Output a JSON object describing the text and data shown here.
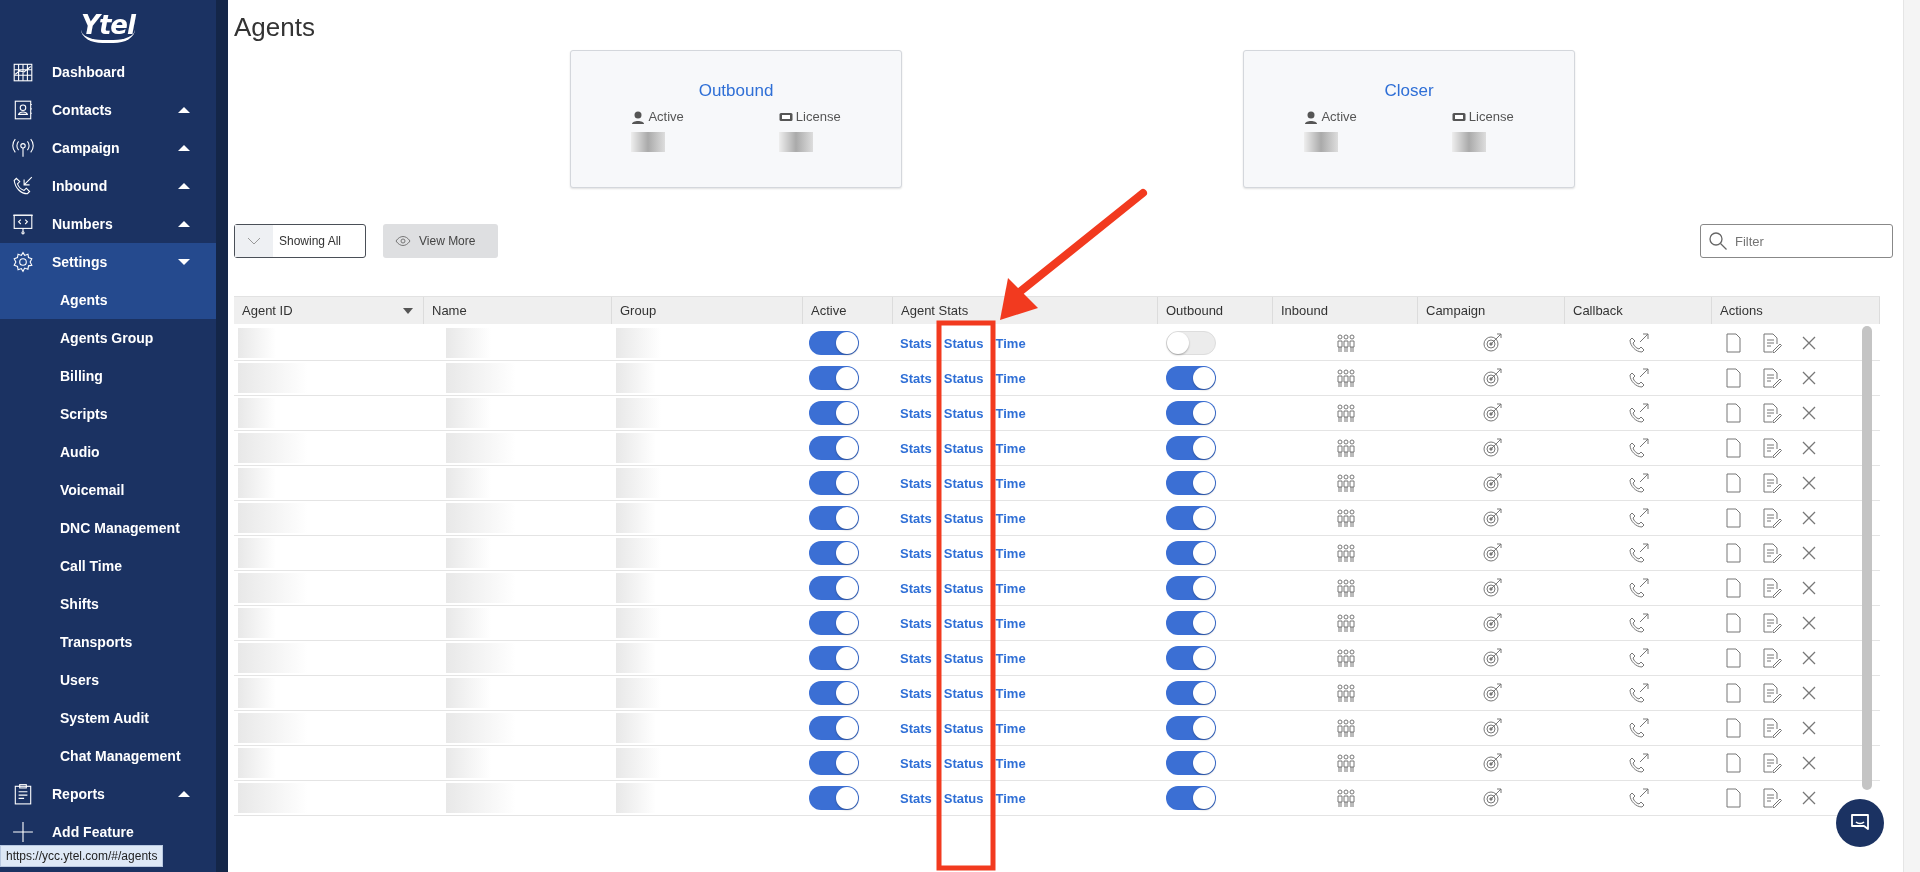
{
  "sidebar": {
    "logo": "Ytel",
    "items": [
      {
        "kind": "link",
        "label": "Dashboard"
      },
      {
        "kind": "group",
        "label": "Contacts",
        "expanded": false
      },
      {
        "kind": "group",
        "label": "Campaign",
        "expanded": false
      },
      {
        "kind": "group",
        "label": "Inbound",
        "expanded": false
      },
      {
        "kind": "group",
        "label": "Numbers",
        "expanded": false
      },
      {
        "kind": "group",
        "label": "Settings",
        "expanded": true,
        "children": [
          {
            "label": "Agents",
            "selected": true
          },
          {
            "label": "Agents Group",
            "selected": false
          },
          {
            "label": "Billing",
            "selected": false
          },
          {
            "label": "Scripts",
            "selected": false
          },
          {
            "label": "Audio",
            "selected": false
          },
          {
            "label": "Voicemail",
            "selected": false
          },
          {
            "label": "DNC Management",
            "selected": false
          },
          {
            "label": "Call Time",
            "selected": false
          },
          {
            "label": "Shifts",
            "selected": false
          },
          {
            "label": "Transports",
            "selected": false
          },
          {
            "label": "Users",
            "selected": false
          },
          {
            "label": "System Audit",
            "selected": false
          },
          {
            "label": "Chat Management",
            "selected": false
          }
        ]
      },
      {
        "kind": "group",
        "label": "Reports",
        "expanded": false
      },
      {
        "kind": "link",
        "label": "Add Feature"
      }
    ]
  },
  "link_preview": "https://ycc.ytel.com/#/agents",
  "page_title": "Agents",
  "cards": [
    {
      "title": "Outbound",
      "active_label": "Active",
      "license_label": "License"
    },
    {
      "title": "Closer",
      "active_label": "Active",
      "license_label": "License"
    }
  ],
  "toolbar": {
    "filter_button": "Showing All",
    "view_more_button": "View More",
    "search": {
      "placeholder": "Filter"
    }
  },
  "table": {
    "columns": [
      "Agent ID",
      "Name",
      "Group",
      "Active",
      "Agent Stats",
      "Outbound",
      "Inbound",
      "Campaign",
      "Callback",
      "Actions"
    ],
    "rows": [
      {
        "active": true,
        "outbound": false,
        "links": [
          "Stats",
          "Status",
          "Time"
        ]
      },
      {
        "active": true,
        "outbound": true,
        "links": [
          "Stats",
          "Status",
          "Time"
        ]
      },
      {
        "active": true,
        "outbound": true,
        "links": [
          "Stats",
          "Status",
          "Time"
        ]
      },
      {
        "active": true,
        "outbound": true,
        "links": [
          "Stats",
          "Status",
          "Time"
        ]
      },
      {
        "active": true,
        "outbound": true,
        "links": [
          "Stats",
          "Status",
          "Time"
        ]
      },
      {
        "active": true,
        "outbound": true,
        "links": [
          "Stats",
          "Status",
          "Time"
        ]
      },
      {
        "active": true,
        "outbound": true,
        "links": [
          "Stats",
          "Status",
          "Time"
        ]
      },
      {
        "active": true,
        "outbound": true,
        "links": [
          "Stats",
          "Status",
          "Time"
        ]
      },
      {
        "active": true,
        "outbound": true,
        "links": [
          "Stats",
          "Status",
          "Time"
        ]
      },
      {
        "active": true,
        "outbound": true,
        "links": [
          "Stats",
          "Status",
          "Time"
        ]
      },
      {
        "active": true,
        "outbound": true,
        "links": [
          "Stats",
          "Status",
          "Time"
        ]
      },
      {
        "active": true,
        "outbound": true,
        "links": [
          "Stats",
          "Status",
          "Time"
        ]
      },
      {
        "active": true,
        "outbound": true,
        "links": [
          "Stats",
          "Status",
          "Time"
        ]
      },
      {
        "active": true,
        "outbound": true,
        "links": [
          "Stats",
          "Status",
          "Time"
        ]
      }
    ]
  }
}
